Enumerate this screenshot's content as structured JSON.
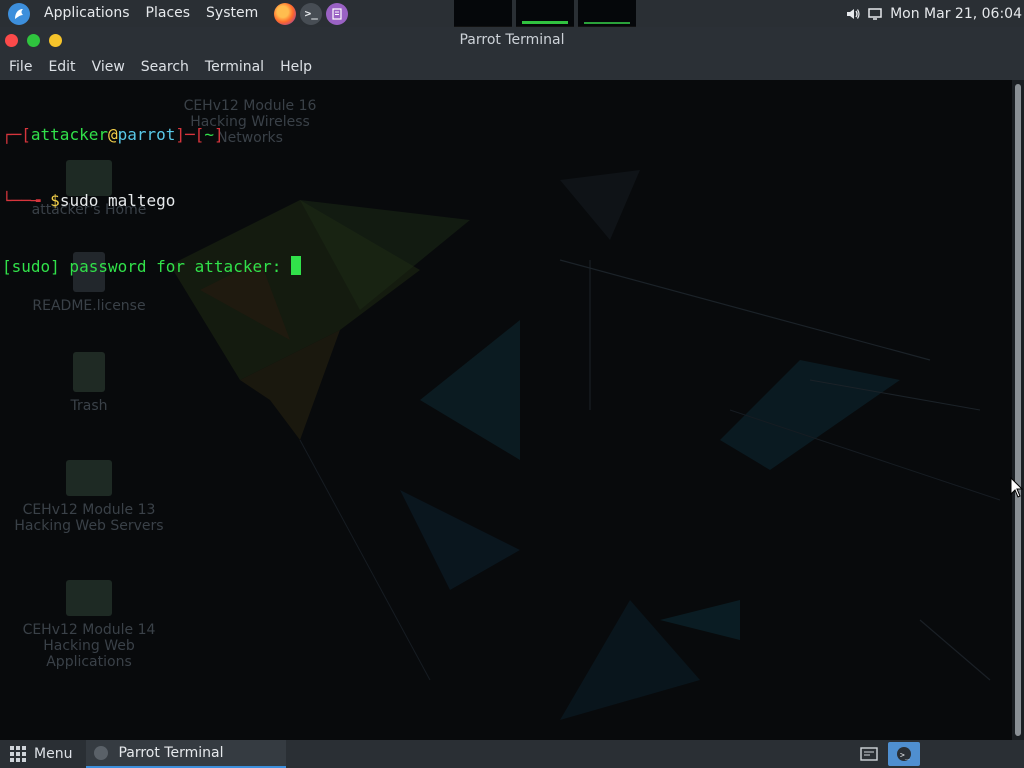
{
  "top_panel": {
    "menus": [
      "Applications",
      "Places",
      "System"
    ],
    "launchers": [
      "firefox-icon",
      "terminal-icon",
      "notes-icon"
    ],
    "clock": "Mon Mar 21, 06:04",
    "tray_icons": [
      "volume-icon",
      "display-icon"
    ]
  },
  "window": {
    "title": "Parrot Terminal",
    "menu": [
      "File",
      "Edit",
      "View",
      "Search",
      "Terminal",
      "Help"
    ]
  },
  "terminal": {
    "prompt_open": "┌─[",
    "user": "attacker",
    "at": "@",
    "host": "parrot",
    "sep": "]─[",
    "cwd": "~",
    "prompt_close": "]",
    "line2_prefix": "└──╼ ",
    "dollar": "$",
    "command": "sudo maltego",
    "output": "[sudo] password for attacker: "
  },
  "desktop_ghosts": {
    "home": "attacker's Home",
    "readme": "README.license",
    "trash": "Trash",
    "module13": "CEHv12 Module 13 Hacking Web Servers",
    "module14": "CEHv12 Module 14 Hacking Web Applications",
    "module16": "CEHv12 Module 16 Hacking Wireless Networks"
  },
  "bottom_panel": {
    "menu_label": "Menu",
    "task_label": "Parrot Terminal"
  },
  "colors": {
    "panel_bg": "#2a2f34",
    "terminal_bg": "#080a0c",
    "prompt_red": "#d7353d",
    "prompt_green": "#31e14a",
    "prompt_cyan": "#59c9e8",
    "accent_blue": "#3d8fdc"
  }
}
